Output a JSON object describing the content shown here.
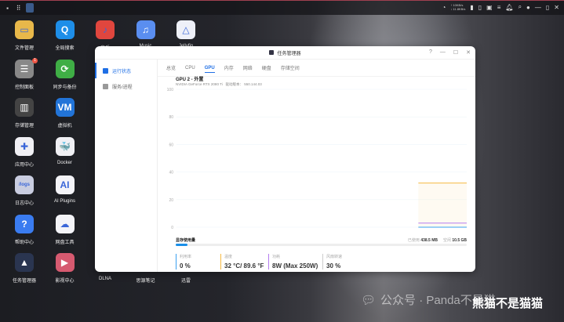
{
  "desktop": {
    "icons": [
      {
        "label": "文件管理",
        "color": "#e8b84a",
        "glyph": "▭"
      },
      {
        "label": "全局搜索",
        "color": "#1e8ee8",
        "glyph": "Q"
      },
      {
        "label": "音乐",
        "color": "#e0463e",
        "glyph": "♪"
      },
      {
        "label": "Music",
        "color": "#5a8ef0",
        "glyph": "♫"
      },
      {
        "label": "Jellyfin",
        "color": "#eef0f8",
        "glyph": "△"
      },
      {
        "label": "控制面板",
        "color": "#888",
        "glyph": "☰",
        "badge": "1"
      },
      {
        "label": "同步与备份",
        "color": "#3fae45",
        "glyph": "⟳"
      },
      {
        "label": "存储管理",
        "color": "#444",
        "glyph": "▥"
      },
      {
        "label": "虚拟机",
        "color": "#2274d8",
        "glyph": "VM"
      },
      {
        "label": "应用中心",
        "color": "#f0f0f4",
        "glyph": "✚"
      },
      {
        "label": "Docker",
        "color": "#f0f0f4",
        "glyph": "🐳"
      },
      {
        "label": "日志中心",
        "color": "#c9cde0",
        "glyph": "/logs"
      },
      {
        "label": "AI Plugins",
        "color": "#f4f4f8",
        "glyph": "AI"
      },
      {
        "label": "帮助中心",
        "color": "#3a7cf0",
        "glyph": "?"
      },
      {
        "label": "网盘工具",
        "color": "#f4f4f8",
        "glyph": "☁"
      },
      {
        "label": "任务管理器",
        "color": "#2a3550",
        "glyph": "▲"
      },
      {
        "label": "影视中心",
        "color": "#d65a70",
        "glyph": "▶"
      },
      {
        "label": "DLNA",
        "color": "",
        "glyph": ""
      },
      {
        "label": "思源笔记",
        "color": "",
        "glyph": ""
      },
      {
        "label": "迅雷",
        "color": "",
        "glyph": ""
      }
    ]
  },
  "topbar": {
    "net_up": "↑ 10KB/s",
    "net_down": "↓ 11.8KB/s"
  },
  "window": {
    "title": "任务管理器",
    "help": "?",
    "sidebar": [
      {
        "label": "运行状态",
        "active": true
      },
      {
        "label": "服务/进程",
        "active": false
      }
    ],
    "tabs": [
      "总览",
      "CPU",
      "GPU",
      "内存",
      "网络",
      "硬盘",
      "存储空间"
    ],
    "active_tab": "GPU",
    "gpu_title": "GPU 2 - 外置",
    "gpu_model": "NVIDIA GeForce RTX 2080 Ti",
    "driver_label": "驱动版本：",
    "driver_version": "550.144.03",
    "mem": {
      "label": "显存使用量",
      "used_label": "已使用",
      "used": "438.5 MB",
      "free_label": "空闲",
      "free": "10.5 GB",
      "used_fraction": 0.04
    },
    "stats": [
      {
        "label": "利用率",
        "value": "0 %",
        "color": "#3aa0f0"
      },
      {
        "label": "温度",
        "value": "32 °C/ 89.6 °F",
        "color": "#f5b942"
      },
      {
        "label": "功耗",
        "value": "8W (Max 250W)",
        "color": "#b57cf0"
      },
      {
        "label": "风扇转速",
        "value": "30 %",
        "color": "#cccccc"
      }
    ]
  },
  "chart_data": {
    "type": "line",
    "ylim": [
      0,
      100
    ],
    "yticks": [
      "100",
      "80",
      "60",
      "40",
      "20",
      "0"
    ],
    "x_range": [
      0,
      60
    ],
    "series": [
      {
        "name": "温度",
        "color": "#f5b942",
        "x": [
          50,
          60
        ],
        "values": [
          32,
          32
        ],
        "fill": true
      },
      {
        "name": "功耗",
        "color": "#b57cf0",
        "x": [
          50,
          60
        ],
        "values": [
          3,
          3
        ]
      },
      {
        "name": "利用率",
        "color": "#3aa0f0",
        "x": [
          50,
          60
        ],
        "values": [
          0,
          0
        ]
      }
    ]
  },
  "watermark": {
    "text": "公众号 · Panda不是猫",
    "author": "熊猫不是猫猫"
  }
}
